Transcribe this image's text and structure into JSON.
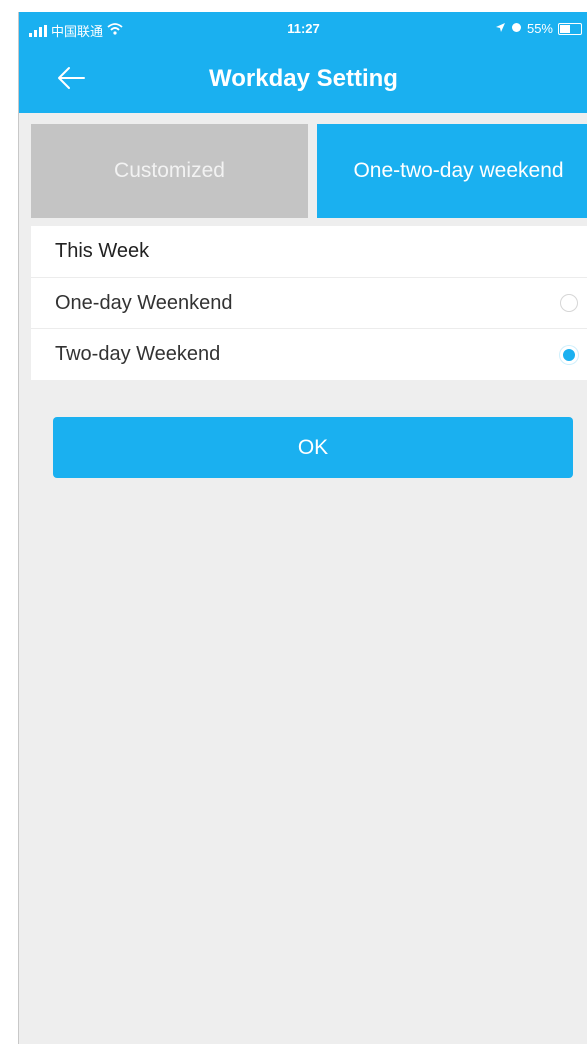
{
  "status_bar": {
    "carrier": "中国联通",
    "time": "11:27",
    "battery": "55%",
    "battery_level": 0.55
  },
  "header": {
    "title": "Workday Setting",
    "back_icon": "arrow-left-icon"
  },
  "tabs": [
    {
      "label": "Customized",
      "active": false
    },
    {
      "label": "One-two-day weekend",
      "active": true
    }
  ],
  "list": {
    "section_title": "This Week",
    "options": [
      {
        "label": "One-day Weenkend",
        "selected": false
      },
      {
        "label": "Two-day Weekend",
        "selected": true
      }
    ]
  },
  "ok_label": "OK",
  "colors": {
    "accent": "#1ab0f0",
    "inactive_tab": "#c4c4c4",
    "background": "#eeeeee"
  }
}
